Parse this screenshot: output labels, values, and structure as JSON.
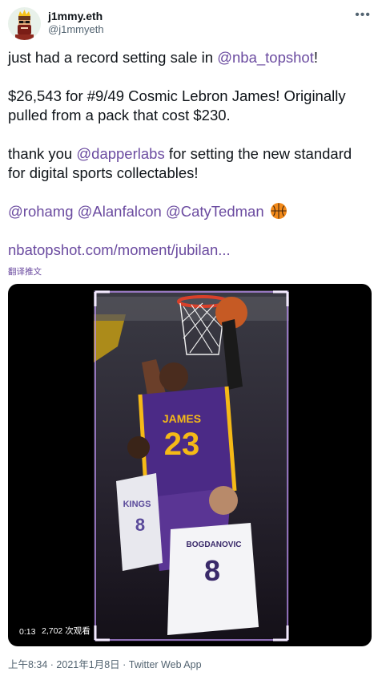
{
  "user": {
    "display_name": "j1mmy.eth",
    "handle": "@j1mmyeth"
  },
  "more_label": "•••",
  "tweet": {
    "line1_pre": "just had a record setting sale in ",
    "line1_mention": "@nba_topshot",
    "line1_post": "!",
    "line2": "$26,543 for #9/49 Cosmic Lebron James! Originally pulled from a pack that cost $230.",
    "line3_pre": "thank you ",
    "line3_mention": "@dapperlabs",
    "line3_post": " for setting the new standard for digital sports collectables!",
    "mentions": [
      "@rohamg",
      "@Alanfalcon",
      "@CatyTedman"
    ],
    "link": "nbatopshot.com/moment/jubilan..."
  },
  "translate_label": "翻译推文",
  "video": {
    "time": "0:13",
    "views": "2,702 次观看",
    "jersey_name": "JAMES",
    "jersey_number": "23",
    "opponent_name": "BOGDANOVIC",
    "opponent_number": "8",
    "opponent2_text": "KINGS",
    "opponent2_number": "8"
  },
  "footer": "上午8:34 · 2021年1月8日 · Twitter Web App",
  "colors": {
    "link": "#6b4ba0",
    "secondary_text": "#536471",
    "lakers_purple": "#4b2a86",
    "lakers_gold": "#f5b917"
  }
}
